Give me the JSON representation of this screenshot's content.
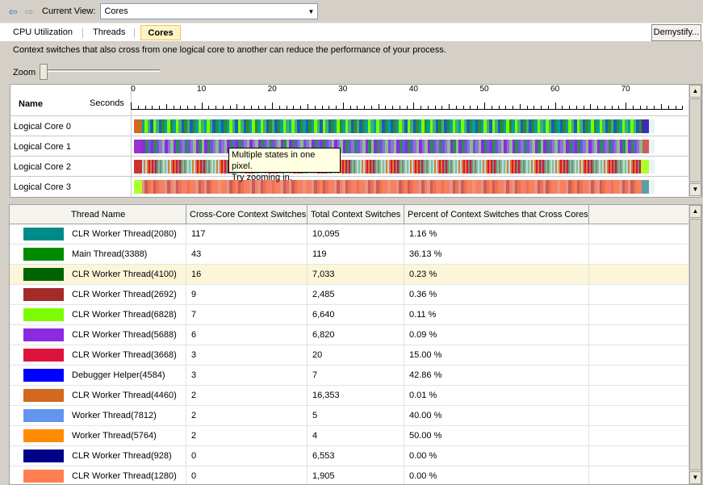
{
  "view": {
    "label": "Current View:",
    "value": "Cores"
  },
  "tabs": {
    "cpu": "CPU Utilization",
    "threads": "Threads",
    "cores": "Cores"
  },
  "demystify": "Demystify...",
  "description": "Context switches that also cross from one logical core to another can reduce the performance of your process.",
  "zoom": {
    "label": "Zoom",
    "level": 0
  },
  "timeline": {
    "name_header": "Name",
    "seconds_header": "Seconds",
    "tick_labels": [
      "0",
      "10",
      "20",
      "30",
      "40",
      "50",
      "60",
      "70"
    ],
    "rows": [
      {
        "label": "Logical Core 0",
        "palette": [
          "#2e8b2e",
          "#7cfc00",
          "#1a5fb4",
          "#00a0a0",
          "#3cb371"
        ],
        "leading": "#d2691e",
        "end_color": "#3a2fb0"
      },
      {
        "label": "Logical Core 1",
        "palette": [
          "#8a2be2",
          "#6a5acd",
          "#8fbc8f",
          "#2e8b57",
          "#9370db"
        ],
        "leading": "#9932cc",
        "end_color": "#cd5c5c"
      },
      {
        "label": "Logical Core 2",
        "palette": [
          "#e07a30",
          "#6f8f7f",
          "#b0e0e6",
          "#dc143c",
          "#8fbc8f"
        ],
        "leading": "#cd3333",
        "end_color": "#adff2f"
      },
      {
        "label": "Logical Core 3",
        "palette": [
          "#e8735a",
          "#f08070",
          "#cd5c5c",
          "#ff7f50",
          "#e9967a"
        ],
        "leading": "#adff2f",
        "end_color": "#5f9ea0"
      }
    ]
  },
  "tooltip": {
    "line1": "Multiple states in one pixel.",
    "line2": "Try zooming in."
  },
  "table": {
    "headers": [
      "Thread Name",
      "Cross-Core Context Switches",
      "Total Context Switches",
      "Percent of Context Switches that Cross Cores"
    ],
    "rows": [
      {
        "color": "#008b8b",
        "name": "CLR Worker Thread(2080)",
        "cross": "117",
        "total": "10,095",
        "percent": "1.16 %"
      },
      {
        "color": "#008b00",
        "name": "Main Thread(3388)",
        "cross": "43",
        "total": "119",
        "percent": "36.13 %"
      },
      {
        "color": "#006400",
        "name": "CLR Worker Thread(4100)",
        "cross": "16",
        "total": "7,033",
        "percent": "0.23 %"
      },
      {
        "color": "#a52a2a",
        "name": "CLR Worker Thread(2692)",
        "cross": "9",
        "total": "2,485",
        "percent": "0.36 %"
      },
      {
        "color": "#7cfc00",
        "name": "CLR Worker Thread(6828)",
        "cross": "7",
        "total": "6,640",
        "percent": "0.11 %"
      },
      {
        "color": "#8a2be2",
        "name": "CLR Worker Thread(5688)",
        "cross": "6",
        "total": "6,820",
        "percent": "0.09 %"
      },
      {
        "color": "#dc143c",
        "name": "CLR Worker Thread(3668)",
        "cross": "3",
        "total": "20",
        "percent": "15.00 %"
      },
      {
        "color": "#0000ff",
        "name": "Debugger Helper(4584)",
        "cross": "3",
        "total": "7",
        "percent": "42.86 %"
      },
      {
        "color": "#d2691e",
        "name": "CLR Worker Thread(4460)",
        "cross": "2",
        "total": "16,353",
        "percent": "0.01 %"
      },
      {
        "color": "#6495ed",
        "name": "Worker Thread(7812)",
        "cross": "2",
        "total": "5",
        "percent": "40.00 %"
      },
      {
        "color": "#ff8c00",
        "name": "Worker Thread(5764)",
        "cross": "2",
        "total": "4",
        "percent": "50.00 %"
      },
      {
        "color": "#00008b",
        "name": "CLR Worker Thread(928)",
        "cross": "0",
        "total": "6,553",
        "percent": "0.00 %"
      },
      {
        "color": "#ff7f50",
        "name": "CLR Worker Thread(1280)",
        "cross": "0",
        "total": "1,905",
        "percent": "0.00 %"
      }
    ],
    "selected_index": 2
  }
}
